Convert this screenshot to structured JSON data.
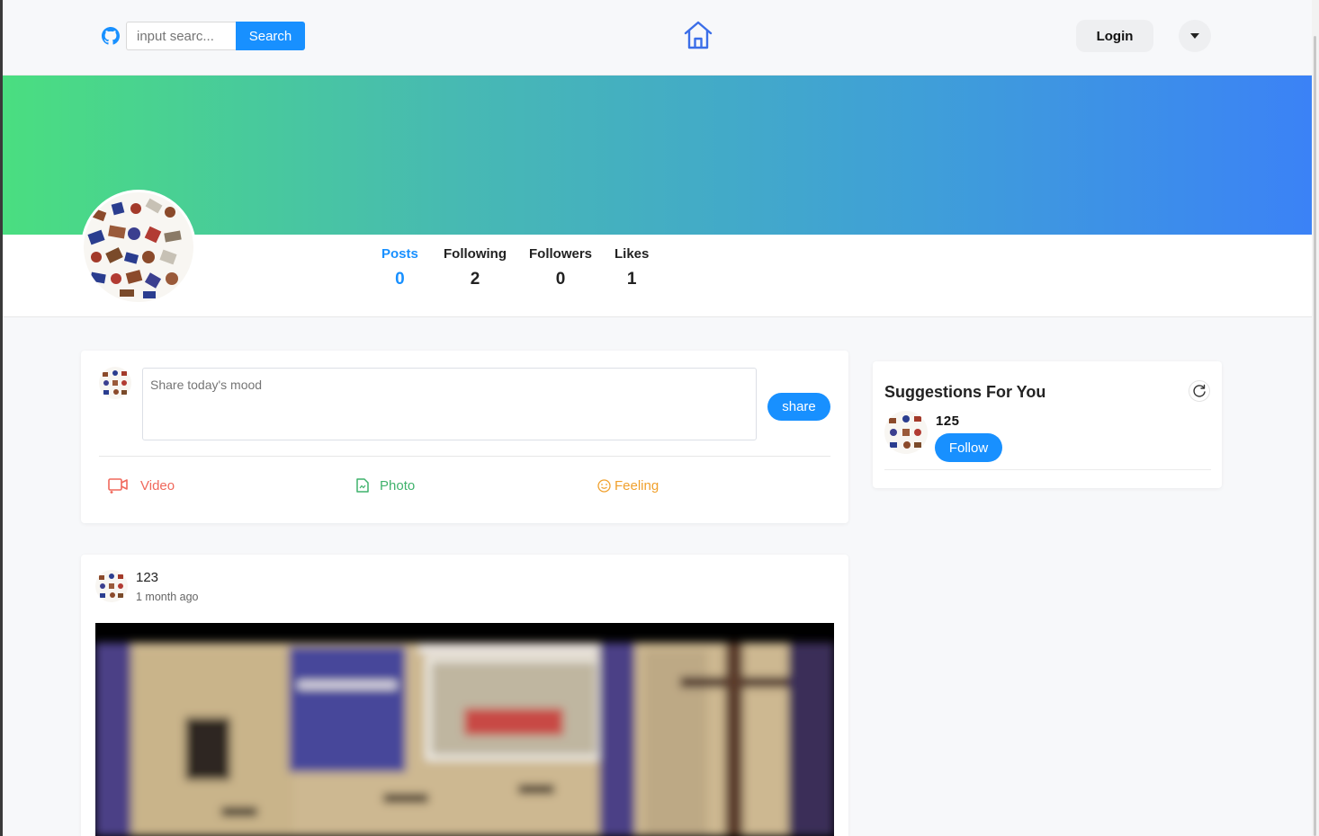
{
  "header": {
    "search_placeholder": "input searc...",
    "search_label": "Search",
    "login_label": "Login"
  },
  "profile": {
    "stats": [
      {
        "label": "Posts",
        "value": "0"
      },
      {
        "label": "Following",
        "value": "2"
      },
      {
        "label": "Followers",
        "value": "0"
      },
      {
        "label": "Likes",
        "value": "1"
      }
    ],
    "active_stat": "Posts"
  },
  "composer": {
    "placeholder": "Share today's mood",
    "share_label": "share",
    "actions": [
      {
        "label": "Video",
        "icon": "video-icon",
        "color": "#f0685b"
      },
      {
        "label": "Photo",
        "icon": "photo-icon",
        "color": "#3fb26b"
      },
      {
        "label": "Feeling",
        "icon": "smile-icon",
        "color": "#f0a02c"
      }
    ]
  },
  "suggestions": {
    "title": "Suggestions For You",
    "items": [
      {
        "name": "125",
        "follow_label": "Follow"
      }
    ]
  },
  "post": {
    "author": "123",
    "time": "1 month ago"
  },
  "colors": {
    "accent": "#1890ff",
    "banner_start": "#4ade80",
    "banner_end": "#3b82f6"
  }
}
